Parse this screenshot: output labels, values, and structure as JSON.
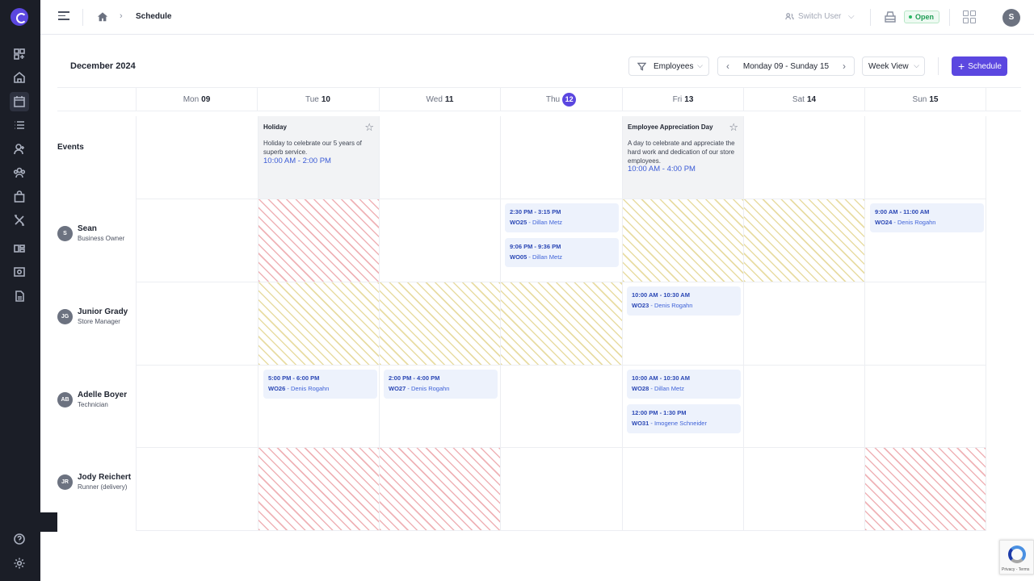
{
  "breadcrumb": {
    "current": "Schedule"
  },
  "header": {
    "switch_user": "Switch User",
    "status_badge": "Open",
    "user_initial": "S"
  },
  "toolbar": {
    "month": "December 2024",
    "filter_label": "Employees",
    "range_label": "Monday 09 - Sunday 15",
    "view_label": "Week View",
    "schedule_button": "Schedule"
  },
  "days": [
    {
      "name": "Mon",
      "num": "09"
    },
    {
      "name": "Tue",
      "num": "10"
    },
    {
      "name": "Wed",
      "num": "11"
    },
    {
      "name": "Thu",
      "num": "12",
      "today": true
    },
    {
      "name": "Fri",
      "num": "13"
    },
    {
      "name": "Sat",
      "num": "14"
    },
    {
      "name": "Sun",
      "num": "15"
    }
  ],
  "events_label": "Events",
  "events": [
    {
      "title": "Holiday",
      "description": "Holiday to celebrate our 5 years of superb service.",
      "time": "10:00 AM - 2:00 PM"
    },
    {
      "title": "Employee Appreciation Day",
      "description": "A day to celebrate and appreciate the hard work and dedication of our store employees.",
      "time": "10:00 AM - 4:00 PM"
    }
  ],
  "employees": [
    {
      "initials": "S",
      "name": "Sean",
      "role": "Business Owner"
    },
    {
      "initials": "JG",
      "name": "Junior Grady",
      "role": "Store Manager"
    },
    {
      "initials": "AB",
      "name": "Adelle Boyer",
      "role": "Technician"
    },
    {
      "initials": "JR",
      "name": "Jody Reichert",
      "role": "Runner (delivery)"
    }
  ],
  "appointments": [
    {
      "time": "2:30 PM - 3:15 PM",
      "wo": "WO25",
      "person": "Dillan Metz"
    },
    {
      "time": "9:06 PM - 9:36 PM",
      "wo": "WO05",
      "person": "Dillan Metz"
    },
    {
      "time": "9:00 AM - 11:00 AM",
      "wo": "WO24",
      "person": "Denis Rogahn"
    },
    {
      "time": "10:00 AM - 10:30 AM",
      "wo": "WO23",
      "person": "Denis Rogahn"
    },
    {
      "time": "5:00 PM - 6:00 PM",
      "wo": "WO26",
      "person": "Denis Rogahn"
    },
    {
      "time": "2:00 PM - 4:00 PM",
      "wo": "WO27",
      "person": "Denis Rogahn"
    },
    {
      "time": "10:00 AM - 10:30 AM",
      "wo": "WO28",
      "person": "Dillan Metz"
    },
    {
      "time": "12:00 PM - 1:30 PM",
      "wo": "WO31",
      "person": "Imogene Schneider"
    }
  ],
  "recaptcha": {
    "text": "Privacy - Terms"
  },
  "icons": {
    "sidebar": [
      "logo-icon",
      "dashboard-add-icon",
      "home-icon",
      "calendar-icon",
      "list-icon",
      "add-user-icon",
      "team-icon",
      "shopping-bag-icon",
      "tools-icon",
      "inventory-icon",
      "cash-icon",
      "report-icon",
      "help-icon",
      "settings-icon"
    ]
  },
  "colors": {
    "accent": "#5b47e0",
    "sidebar": "#1b1e27",
    "open_badge": "#1f9d55",
    "appointment_text": "#2b48b5"
  }
}
